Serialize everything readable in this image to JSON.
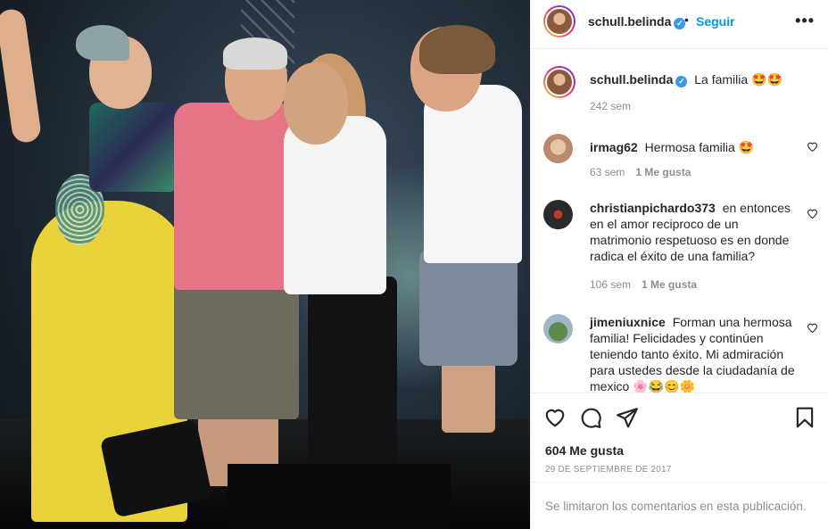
{
  "post": {
    "username": "schull.belinda",
    "verified_mark": "✓",
    "separator": "•",
    "follow_label": "Seguir",
    "more_label": "•••",
    "caption": "La familia 🤩🤩",
    "caption_time": "242 sem"
  },
  "comments": [
    {
      "username": "irmag62",
      "text": "Hermosa familia 🤩",
      "time": "63 sem",
      "likes": "1 Me gusta"
    },
    {
      "username": "christianpichardo373",
      "text": "en entonces en el amor reciproco de un matrimonio respetuoso es en donde radica el éxito de una familia?",
      "time": "106 sem",
      "likes": "1 Me gusta"
    },
    {
      "username": "jimeniuxnice",
      "text": "Forman una hermosa familia! Felicidades y continúen teniendo tanto éxito. Mi admiración para ustedes desde la ciudadanía de mexico 🌸😂😊🌼"
    }
  ],
  "actions": {
    "likes_count": "604 Me gusta",
    "date": "29 DE SEPTIEMBRE DE 2017"
  },
  "footer": {
    "comments_disabled": "Se limitaron los comentarios en esta publicación."
  },
  "icons": [
    "heart-icon",
    "comment-icon",
    "share-icon",
    "bookmark-icon",
    "verified-badge-icon",
    "more-options-icon"
  ],
  "colors": {
    "accent": "#0095f6",
    "verified": "#3897f0",
    "muted": "#8e8e8e",
    "text": "#262626"
  }
}
